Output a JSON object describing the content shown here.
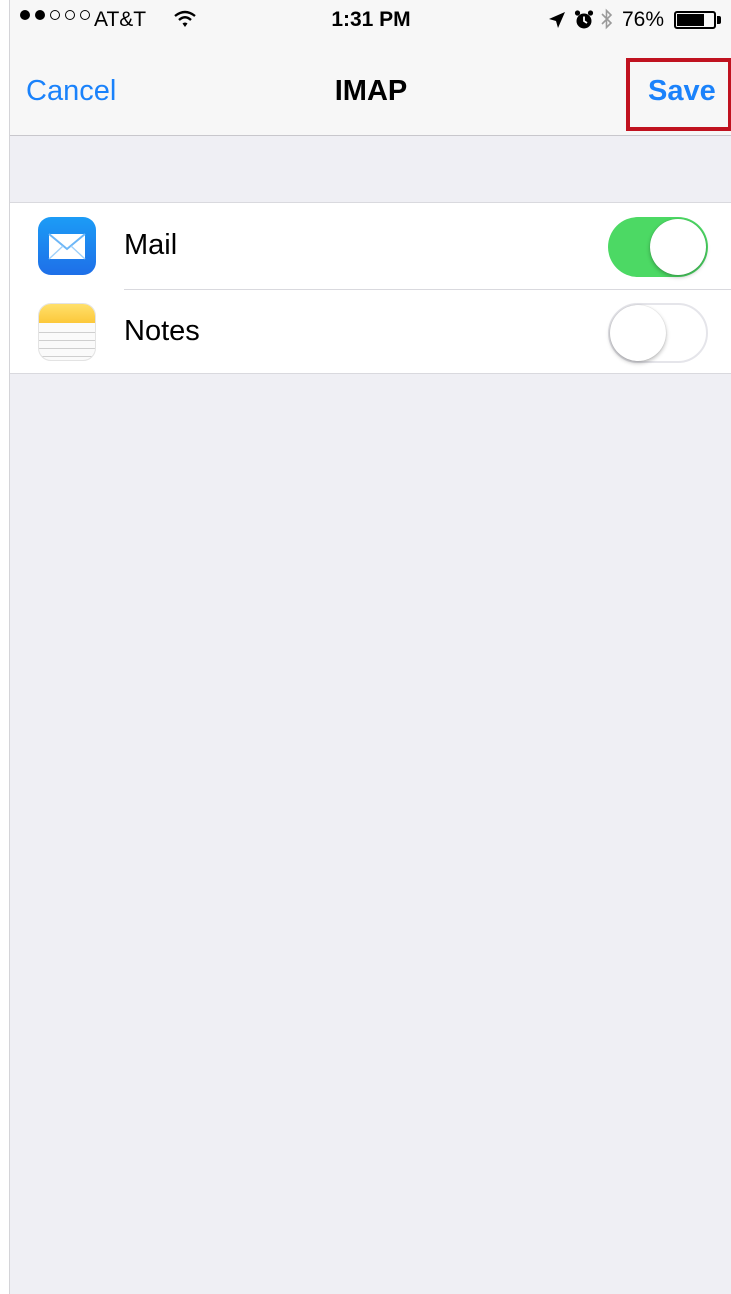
{
  "status_bar": {
    "signal_bars_filled": 2,
    "signal_bars_total": 5,
    "carrier": "AT&T",
    "time": "1:31 PM",
    "battery_percent": "76%",
    "battery_level": 0.76,
    "icons": [
      "wifi-icon",
      "location-arrow-icon",
      "alarm-icon",
      "bluetooth-icon",
      "battery-icon"
    ]
  },
  "nav": {
    "cancel_label": "Cancel",
    "title": "IMAP",
    "save_label": "Save",
    "save_highlight_color": "#c0121f"
  },
  "services": [
    {
      "label": "Mail",
      "icon": "mail-app-icon",
      "enabled": true
    },
    {
      "label": "Notes",
      "icon": "notes-app-icon",
      "enabled": false
    }
  ],
  "colors": {
    "accent": "#1a82fb",
    "toggle_on": "#4cd964",
    "background": "#efeff4"
  }
}
